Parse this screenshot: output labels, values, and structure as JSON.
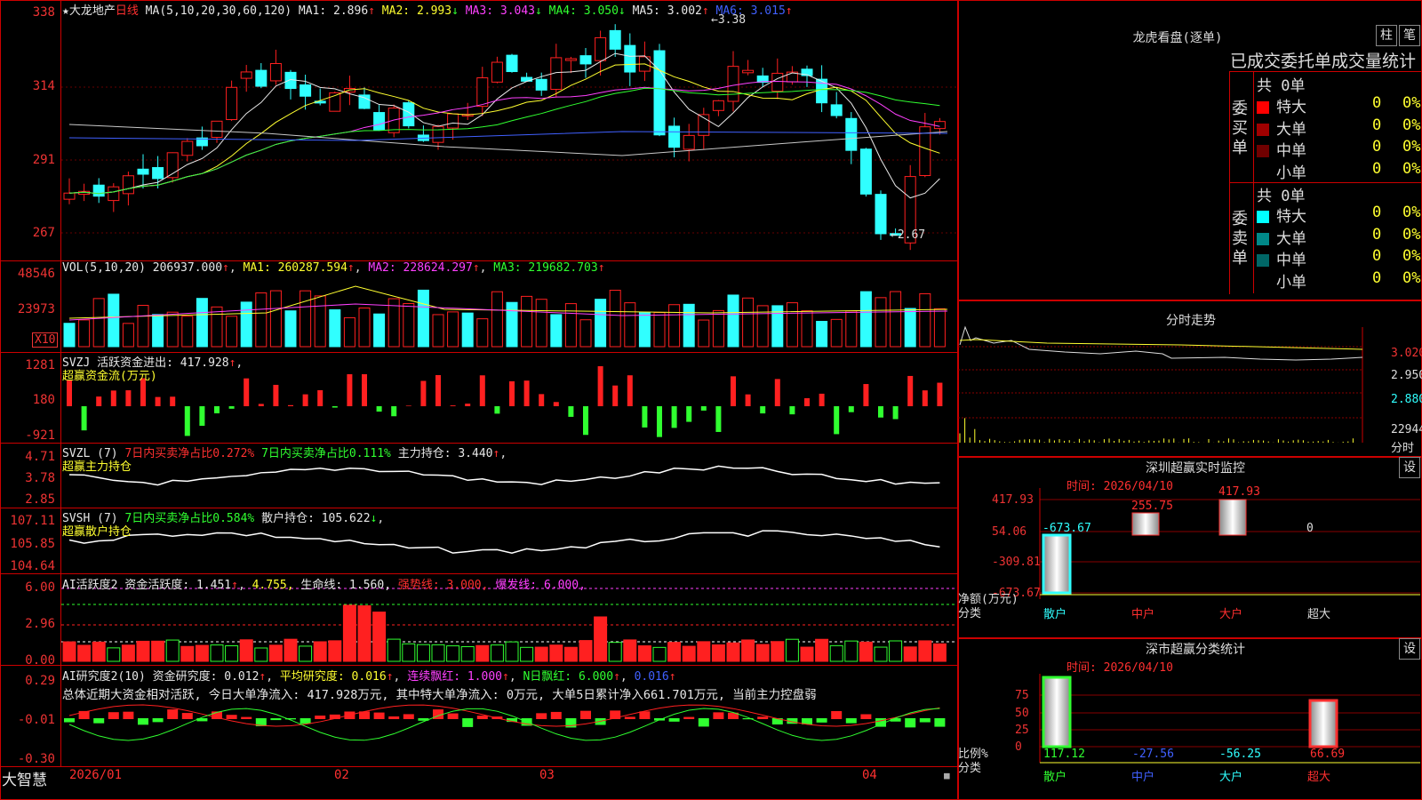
{
  "kline": {
    "title_prefix": "★大龙地产",
    "period": "日线",
    "ma_spec": "MA(5,10,20,30,60,120)",
    "ma_values": [
      {
        "label": "MA1:",
        "value": "2.896",
        "arrow": "↑",
        "color": "#e8e8e8"
      },
      {
        "label": "MA2:",
        "value": "2.993",
        "arrow": "↓",
        "color": "#ffff30"
      },
      {
        "label": "MA3:",
        "value": "3.043",
        "arrow": "↓",
        "color": "#ff40ff"
      },
      {
        "label": "MA4:",
        "value": "3.050",
        "arrow": "↓",
        "color": "#30ff30"
      },
      {
        "label": "MA5:",
        "value": "3.002",
        "arrow": "↑",
        "color": "#e8e8e8"
      },
      {
        "label": "MA6:",
        "value": "3.015",
        "arrow": "↑",
        "color": "#4060ff"
      }
    ],
    "y_ticks": [
      "338",
      "314",
      "291",
      "267"
    ],
    "high_label": "3.38",
    "low_label": "2.67"
  },
  "vol": {
    "header": "VOL(5,10,20)",
    "value": "206937.000",
    "ma1": "MA1: 260287.594",
    "ma2": "MA2: 228624.297",
    "ma3": "MA3: 219682.703",
    "y_ticks": [
      "48546",
      "23973"
    ],
    "unit": "X10"
  },
  "svzj": {
    "header": "SVZJ  活跃资金进出: 417.928",
    "subtitle": "超赢资金流(万元)",
    "y_ticks": [
      "1281",
      "180",
      "-921"
    ]
  },
  "svzl": {
    "header": "SVZL (7)",
    "t1": "7日内买卖净占比0.272%",
    "t2": "7日内买卖净占比0.111%",
    "t3": "主力持仓: 3.440",
    "subtitle": "超赢主力持仓",
    "y_ticks": [
      "4.71",
      "3.78",
      "2.85"
    ]
  },
  "svsh": {
    "header": "SVSH (7)",
    "t1": "7日内买卖净占比0.584%",
    "t2": "散户持仓: 105.622",
    "subtitle": "超赢散户持仓",
    "y_ticks": [
      "107.11",
      "105.85",
      "104.64"
    ]
  },
  "ai1": {
    "header": "AI活跃度2",
    "t1": "资金活跃度: 1.451",
    "t2": "4.755,",
    "t3": "生命线: 1.560,",
    "t4": "强势线: 3.000,",
    "t5": "爆发线: 6.000,",
    "y_ticks": [
      "6.00",
      "2.96",
      "0.00"
    ]
  },
  "ai2": {
    "header": "AI研究度2(10)",
    "t1": "资金研究度: 0.012",
    "t2": "平均研究度: 0.016",
    "t3": "连续飘红: 1.000",
    "t4": "N日飘红: 6.000",
    "t5": "0.016",
    "summary": "总体近期大资金相对活跃, 今日大单净流入: 417.928万元, 其中特大单净流入: 0万元, 大单5日累计净入661.701万元, 当前主力控盘弱",
    "y_ticks": [
      "0.29",
      "-0.01",
      "-0.30"
    ]
  },
  "footer": {
    "brand": "大智慧",
    "dates": [
      "2026/01",
      "02",
      "03",
      "04"
    ]
  },
  "lhb": {
    "title": "龙虎看盘(逐单)",
    "btn1": "柱",
    "btn2": "笔",
    "subtitle": "已成交委托单成交量统计",
    "buy_label": "委买单",
    "sell_label": "委卖单",
    "buy_total": "共 0单",
    "sell_total": "共 0单",
    "buy_rows": [
      {
        "name": "特大",
        "count": "0",
        "pct": "0%",
        "color": "#ff0000"
      },
      {
        "name": "大单",
        "count": "0",
        "pct": "0%",
        "color": "#a00000"
      },
      {
        "name": "中单",
        "count": "0",
        "pct": "0%",
        "color": "#700000"
      },
      {
        "name": "小单",
        "count": "0",
        "pct": "0%",
        "color": ""
      }
    ],
    "sell_rows": [
      {
        "name": "特大",
        "count": "0",
        "pct": "0%",
        "color": "#00ffff"
      },
      {
        "name": "大单",
        "count": "0",
        "pct": "0%",
        "color": "#008888"
      },
      {
        "name": "中单",
        "count": "0",
        "pct": "0%",
        "color": "#006666"
      },
      {
        "name": "小单",
        "count": "0",
        "pct": "0%",
        "color": ""
      }
    ]
  },
  "minute": {
    "title": "分时走势",
    "prices": [
      "3.020",
      "2.950",
      "2.880"
    ],
    "vol": "22944",
    "label": "分时"
  },
  "monitor": {
    "title": "深圳超赢实时监控",
    "btn": "设",
    "time": "时间: 2026/04/10",
    "y_ticks": [
      "417.93",
      "54.06",
      "-309.81",
      "-673.67"
    ],
    "values": [
      "-673.67",
      "255.75",
      "417.93",
      "0"
    ],
    "axis1": "净额(万元)",
    "axis2": "分类",
    "cats": [
      "散户",
      "中户",
      "大户",
      "超大"
    ]
  },
  "classify": {
    "title": "深市超赢分类统计",
    "btn": "设",
    "time": "时间: 2026/04/10",
    "y_ticks": [
      "75",
      "50",
      "25",
      "0"
    ],
    "values": [
      "117.12",
      "-27.56",
      "-56.25",
      "66.69"
    ],
    "axis1": "比例%",
    "axis2": "分类",
    "cats": [
      "散户",
      "中户",
      "大户",
      "超大"
    ]
  }
}
